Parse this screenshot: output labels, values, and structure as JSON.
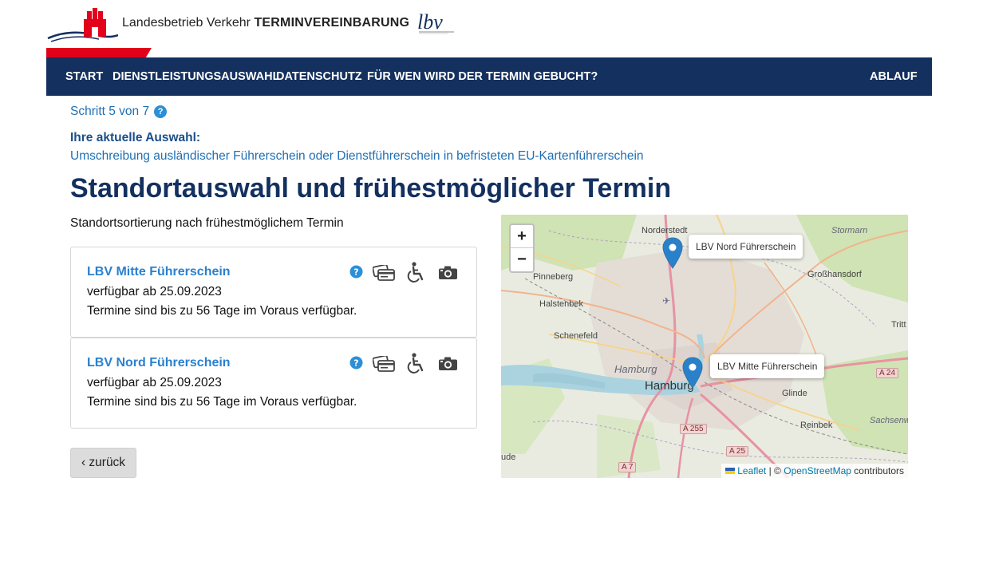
{
  "header": {
    "title_prefix": "Landesbetrieb Verkehr",
    "title_bold": "TERMINVEREINBARUNG",
    "colors": {
      "brand_blue": "#13305f",
      "red": "#e2001a"
    }
  },
  "nav": {
    "items": [
      {
        "label": "START"
      },
      {
        "label": "DIENSTLEISTUNGSAUSWAHL"
      },
      {
        "label": "DATENSCHUTZ"
      },
      {
        "label": "FÜR WEN WIRD DER TERMIN GEBUCHT?"
      }
    ],
    "right_item": "ABLAUF"
  },
  "step": {
    "text": "Schritt 5 von 7",
    "help": "?"
  },
  "selection": {
    "label": "Ihre aktuelle Auswahl:",
    "value": "Umschreibung ausländischer Führerschein oder Dienstführerschein in befristeten EU-Kartenführerschein"
  },
  "page_title": "Standortauswahl und frühestmöglicher Termin",
  "sort_label": "Standortsortierung nach frühestmöglichem Termin",
  "locations": [
    {
      "name": "LBV Mitte Führerschein",
      "available": "verfügbar ab 25.09.2023",
      "note": "Termine sind bis zu 56 Tage im Voraus verfügbar.",
      "icons": [
        "help-icon",
        "payment-cards-icon",
        "wheelchair-icon",
        "camera-icon"
      ]
    },
    {
      "name": "LBV Nord Führerschein",
      "available": "verfügbar ab 25.09.2023",
      "note": "Termine sind bis zu 56 Tage im Voraus verfügbar.",
      "icons": [
        "help-icon",
        "payment-cards-icon",
        "wheelchair-icon",
        "camera-icon"
      ]
    }
  ],
  "back_button": "‹ zurück",
  "map": {
    "zoom_in": "+",
    "zoom_out": "−",
    "popups": [
      "LBV Nord Führerschein",
      "LBV Mitte Führerschein"
    ],
    "places": {
      "norderstedt": "Norderstedt",
      "pinneberg": "Pinneberg",
      "halstenbek": "Halstenbek",
      "schenefeld": "Schenefeld",
      "hamburg_water": "Hamburg",
      "hamburg": "Hamburg",
      "grosshansdorf": "Großhansdorf",
      "stormarn": "Stormarn",
      "glinde": "Glinde",
      "reinbek": "Reinbek",
      "sachsenwald": "Sachsenwa",
      "tritt": "Tritt",
      "ude": "ude"
    },
    "roads": [
      "A 24",
      "A 255",
      "A 25",
      "A 7"
    ],
    "attribution": {
      "leaflet": "Leaflet",
      "separator": "| ©",
      "osm": "OpenStreetMap",
      "suffix": "contributors"
    }
  }
}
